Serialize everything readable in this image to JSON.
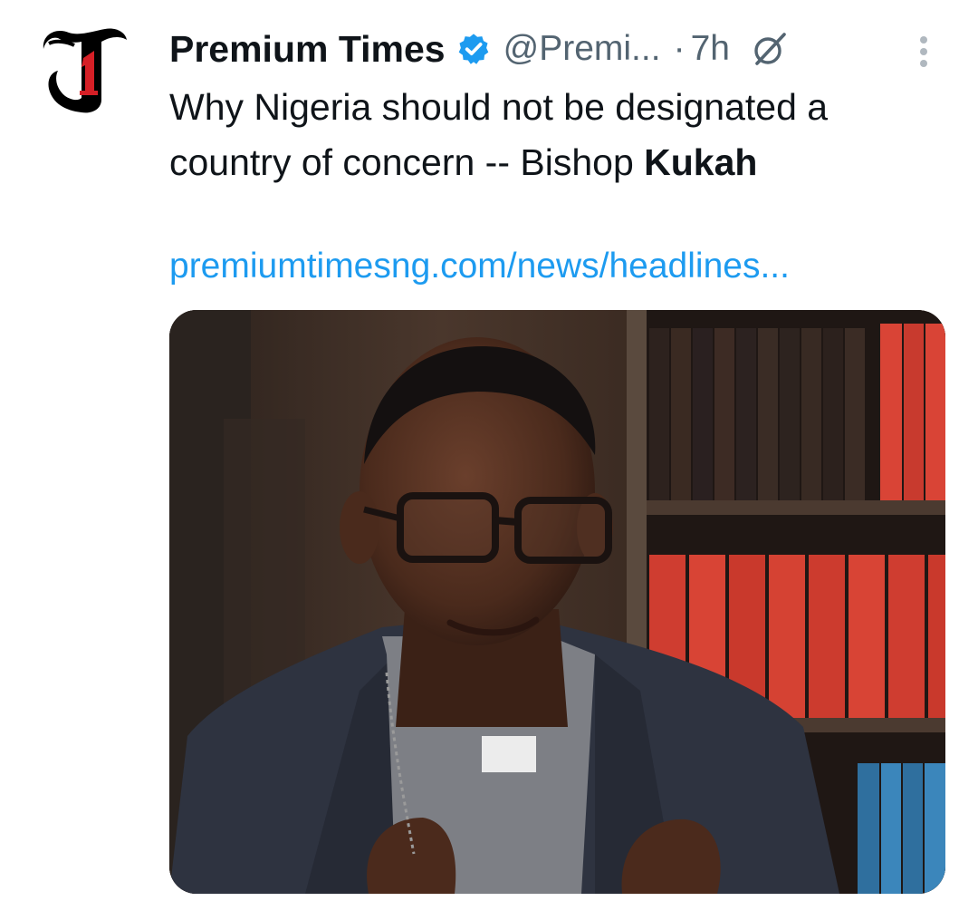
{
  "account": {
    "display_name": "Premium Times",
    "handle": "@Premi...",
    "separator": "·",
    "timestamp": "7h"
  },
  "tweet": {
    "text_prefix": "Why Nigeria should not be designated a country of concern -- Bishop ",
    "text_bold": "Kukah",
    "link": "premiumtimesng.com/news/headlines..."
  },
  "colors": {
    "link": "#1d9bf0",
    "verified": "#1d9bf0",
    "secondary_text": "#536471",
    "primary_text": "#0f1419",
    "logo_red": "#d51f26"
  },
  "icons": {
    "verified": "verified-badge-icon",
    "grok": "grok-icon",
    "more": "more-options-icon"
  },
  "media": {
    "kind": "photo",
    "subject": "man in clerical collar and glasses in front of bookshelves"
  }
}
